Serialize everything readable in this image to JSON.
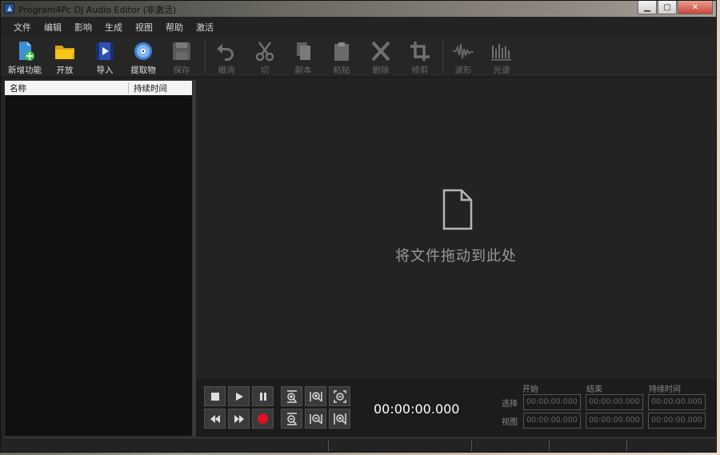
{
  "window": {
    "title": "Program4Pc DJ Audio Editor  (非激活)",
    "min": "▁",
    "max": "▢",
    "close": "✕"
  },
  "menu": [
    "文件",
    "编辑",
    "影响",
    "生成",
    "视图",
    "帮助",
    "激活"
  ],
  "toolbar": [
    {
      "label": "新增功能",
      "icon": "new-features-icon",
      "enabled": true
    },
    {
      "label": "开放",
      "icon": "open-folder-icon",
      "enabled": true
    },
    {
      "label": "导入",
      "icon": "import-video-icon",
      "enabled": true
    },
    {
      "label": "提取物",
      "icon": "extract-disc-icon",
      "enabled": true
    },
    {
      "label": "保存",
      "icon": "save-icon",
      "enabled": false
    },
    {
      "label": "撤消",
      "icon": "undo-icon",
      "enabled": false
    },
    {
      "label": "切",
      "icon": "cut-icon",
      "enabled": false
    },
    {
      "label": "副本",
      "icon": "copy-icon",
      "enabled": false
    },
    {
      "label": "粘贴",
      "icon": "paste-icon",
      "enabled": false
    },
    {
      "label": "删除",
      "icon": "delete-icon",
      "enabled": false
    },
    {
      "label": "修剪",
      "icon": "trim-icon",
      "enabled": false
    },
    {
      "label": "波形",
      "icon": "waveform-icon",
      "enabled": false
    },
    {
      "label": "光谱",
      "icon": "spectrum-icon",
      "enabled": false
    }
  ],
  "file_list": {
    "col_name": "名称",
    "col_duration": "持续时间"
  },
  "main": {
    "drop_text": "将文件拖动到此处"
  },
  "transport": {
    "icons": [
      "stop-icon",
      "play-icon",
      "pause-icon",
      "rewind-icon",
      "fast-forward-icon",
      "record-icon"
    ],
    "zoom_icons": [
      "zoom-in-vertical-icon",
      "zoom-in-horizontal-icon",
      "zoom-out-full-icon",
      "zoom-out-vertical-icon",
      "zoom-out-horizontal-icon",
      "zoom-selection-icon"
    ],
    "time": "00:00:00.000"
  },
  "selection": {
    "col_start": "开始",
    "col_end": "结束",
    "col_duration": "持续时间",
    "row_selection": "选择",
    "row_view": "视图",
    "values": [
      "00:00:00.000",
      "00:00:00.000",
      "00:00:00.000",
      "00:00:00.000",
      "00:00:00.000",
      "00:00:00.000"
    ]
  },
  "colors": {
    "record": "#e0102a",
    "accent": "#f5c518",
    "background": "#232323"
  }
}
